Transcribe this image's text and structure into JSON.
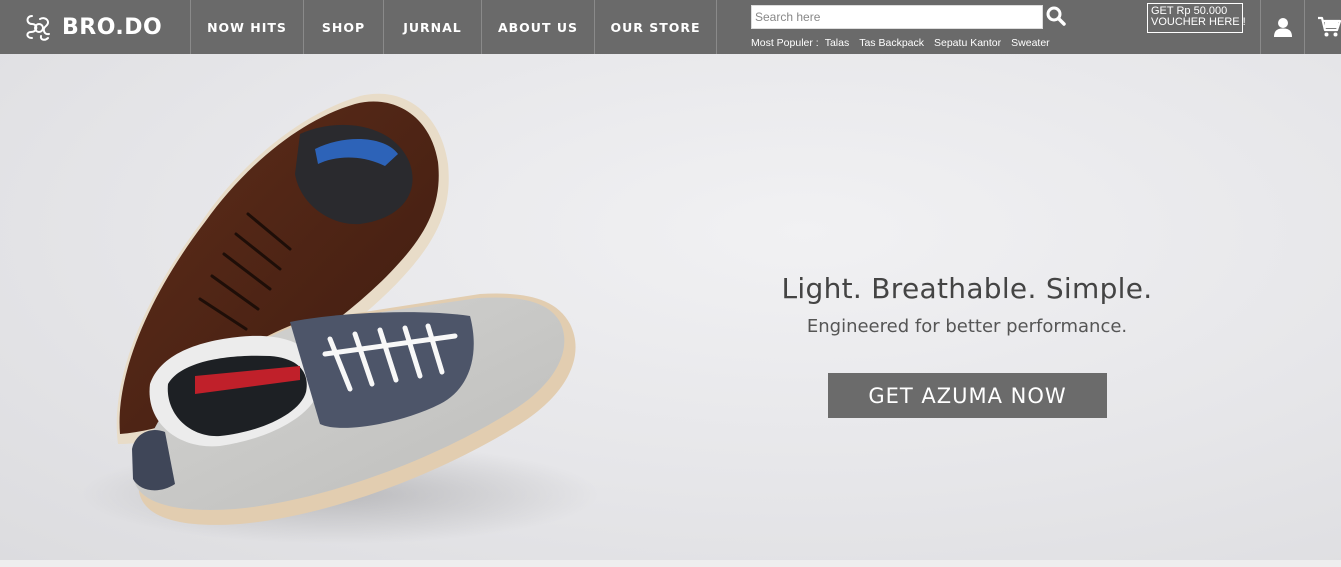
{
  "brand": {
    "name": "BRO.DO",
    "logo_icon": "brodo-monogram-icon"
  },
  "nav": {
    "items": [
      {
        "label": "NOW HITS"
      },
      {
        "label": "SHOP"
      },
      {
        "label": "JURNAL"
      },
      {
        "label": "ABOUT US"
      },
      {
        "label": "OUR STORE"
      }
    ]
  },
  "search": {
    "placeholder": "Search here",
    "value": "",
    "icon": "search-icon",
    "popular_label": "Most Populer :",
    "popular_links": [
      "Talas",
      "Tas Backpack",
      "Sepatu Kantor",
      "Sweater"
    ]
  },
  "voucher": {
    "line1": "GET Rp 50.000",
    "line2": "VOUCHER HERE !"
  },
  "header_icons": {
    "user": "user-icon",
    "cart": "cart-icon"
  },
  "hero": {
    "headline": "Light. Breathable. Simple.",
    "subline": "Engineered for better performance.",
    "cta_label": "GET AZUMA NOW",
    "image": "two-sneakers-brown-and-grey"
  },
  "colors": {
    "topbar": "#6a6a6a",
    "cta": "#6b6b6b",
    "hero_bg": "#e6e6e9",
    "text_dark": "#444444"
  }
}
